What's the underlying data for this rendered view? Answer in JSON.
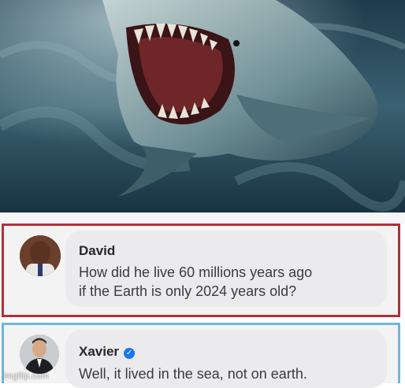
{
  "comments": [
    {
      "author": "David",
      "verified": false,
      "lines": [
        "How did he live 60 millions years ago",
        "if the Earth is only 2024 years old?"
      ]
    },
    {
      "author": "Xavier",
      "verified": true,
      "lines": [
        "Well, it lived in the sea, not on earth."
      ]
    }
  ],
  "watermark": "imgflip.com",
  "colors": {
    "david_border": "#b03037",
    "xavier_border": "#6fb6d8",
    "verified_badge": "#1877f2",
    "card_background": "#f3f3f4"
  },
  "icons": {
    "verified": "verified-check-icon"
  }
}
